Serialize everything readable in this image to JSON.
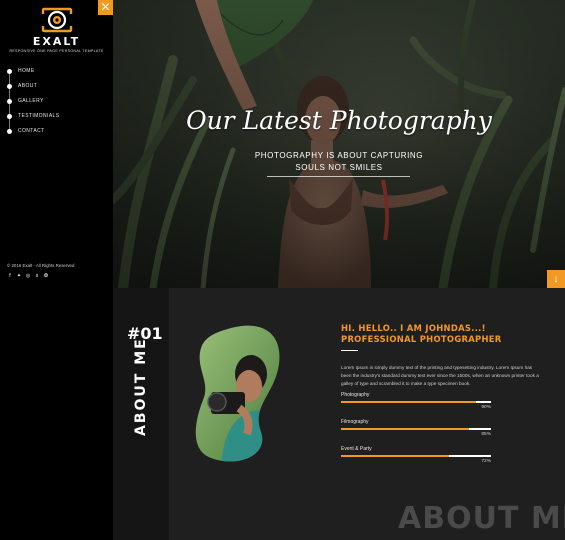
{
  "brand": {
    "name": "EXALT",
    "tagline": "RESPONSIVE ONE PAGE PERSONAL TEMPLATE",
    "accent_color": "#f29a20"
  },
  "sidebar": {
    "close_icon": "close-icon",
    "nav": [
      {
        "label": "HOME"
      },
      {
        "label": "ABOUT"
      },
      {
        "label": "GALLERY"
      },
      {
        "label": "TESTIMONIALS"
      },
      {
        "label": "CONTACT"
      }
    ],
    "copyright": "© 2016 Exalt - All Rights Reserved",
    "social": [
      {
        "name": "facebook-icon",
        "glyph": "f"
      },
      {
        "name": "twitter-icon",
        "glyph": "✦"
      },
      {
        "name": "instagram-icon",
        "glyph": "◎"
      },
      {
        "name": "skype-icon",
        "glyph": "s"
      },
      {
        "name": "dribbble-icon",
        "glyph": "❂"
      }
    ]
  },
  "hero": {
    "title": "Our Latest Photography",
    "subtitle_line1": "PHOTOGRAPHY IS ABOUT CAPTURING",
    "subtitle_line2": "SOULS NOT SMILES",
    "scroll_icon": "arrow-down-icon"
  },
  "about": {
    "number": "#01",
    "vertical_title": "ABOUT ME",
    "heading_line1": "HI. HELLO.. I AM JOHNDAS...!",
    "heading_line2": "PROFESSIONAL PHOTOGRAPHER",
    "paragraph": "Lorem Ipsum is simply dummy text of the printing and typesetting industry. Lorem Ipsum has been the industry's standard dummy text ever since the 1500s, when an unknown printer took a galley of type and scrambled it to make a type specimen book.",
    "skills": [
      {
        "label": "Photography",
        "value": 90,
        "display": "90%"
      },
      {
        "label": "Filmography",
        "value": 85,
        "display": "85%"
      },
      {
        "label": "Event & Party",
        "value": 72,
        "display": "72%"
      }
    ],
    "watermark": "ABOUT ME"
  }
}
